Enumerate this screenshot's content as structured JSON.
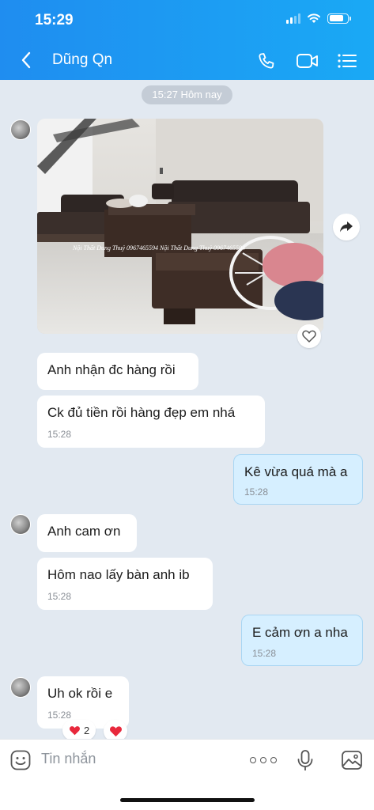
{
  "status_bar": {
    "time": "15:29",
    "battery_level": 0.8,
    "signal_bars": 2
  },
  "header": {
    "contact_name": "Dũng Qn",
    "icons": [
      "back-icon",
      "phone-icon",
      "video-call-icon",
      "menu-list-icon"
    ],
    "accent_color": "#1f8df0"
  },
  "chat": {
    "time_separator": "15:27 Hôm nay",
    "photo_watermark": "Nội Thất Dung Thuỷ 0967465594 Nội Thất Dung Thuỷ 0967465594",
    "messages": [
      {
        "side": "in",
        "text": "Anh nhận đc hàng rồi",
        "time": ""
      },
      {
        "side": "in",
        "text": "Ck đủ tiền rồi hàng đẹp em nhá",
        "time": "15:28"
      },
      {
        "side": "out",
        "text": "Kê vừa quá mà a",
        "time": "15:28"
      },
      {
        "side": "in",
        "text": "Anh cam ơn",
        "time": ""
      },
      {
        "side": "in",
        "text": "Hôm nao lấy bàn anh ib",
        "time": "15:28"
      },
      {
        "side": "out",
        "text": "E cảm ơn a nha",
        "time": "15:28"
      },
      {
        "side": "in",
        "text": "Uh ok rồi e",
        "time": "15:28"
      }
    ],
    "reaction_count": "2"
  },
  "input_bar": {
    "placeholder": "Tin nhắn"
  }
}
